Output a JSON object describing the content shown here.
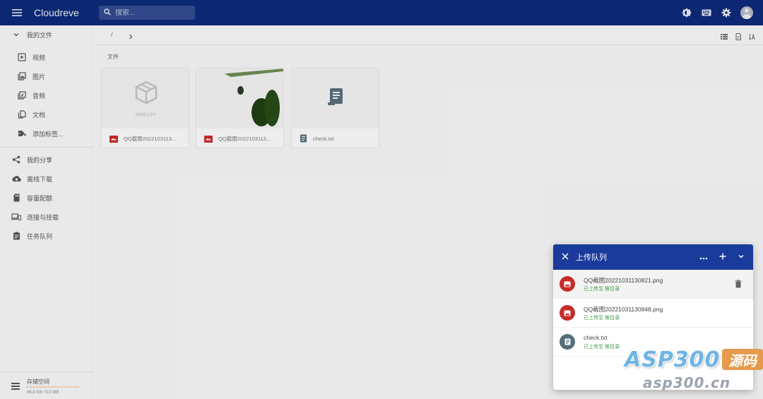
{
  "app": {
    "title": "Cloudreve"
  },
  "search": {
    "placeholder": "搜索..."
  },
  "sidebar": {
    "files_header": "我的文件",
    "sub_items": [
      {
        "label": "视频",
        "icon": "video-icon"
      },
      {
        "label": "图片",
        "icon": "image-icon"
      },
      {
        "label": "音频",
        "icon": "audio-icon"
      },
      {
        "label": "文档",
        "icon": "document-icon"
      },
      {
        "label": "添加标签...",
        "icon": "tag-add-icon"
      }
    ],
    "items": [
      {
        "label": "我的分享",
        "icon": "share-icon"
      },
      {
        "label": "离线下载",
        "icon": "cloud-download-icon"
      },
      {
        "label": "容量配额",
        "icon": "sd-card-icon"
      },
      {
        "label": "连接与挂载",
        "icon": "devices-icon"
      },
      {
        "label": "任务队列",
        "icon": "clipboard-icon"
      }
    ],
    "storage": {
      "label": "存储空间",
      "usage": "98.8 KB / 5.0 MB",
      "used_fraction": 0.02
    }
  },
  "main": {
    "breadcrumb": "/",
    "section_title": "文件",
    "files": [
      {
        "name": "QQ截图2022103113...",
        "type": "image",
        "thumb_text": "缩略图生成中"
      },
      {
        "name": "QQ截图2022103113...",
        "type": "image"
      },
      {
        "name": "check.txt",
        "type": "text"
      }
    ]
  },
  "upload_panel": {
    "title": "上传队列",
    "items": [
      {
        "name": "QQ截图20221031130821.png",
        "status": "已上传至 ",
        "folder": "根目录",
        "type": "image"
      },
      {
        "name": "QQ截图20221031130848.png",
        "status": "已上传至 ",
        "folder": "根目录",
        "type": "image"
      },
      {
        "name": "check.txt",
        "status": "已上传至 ",
        "folder": "根目录",
        "type": "text"
      }
    ]
  },
  "watermark": {
    "brand": "ASP300",
    "badge": "源码",
    "url": "asp300.cn"
  },
  "colors": {
    "appbar": "#0d2a77",
    "panel_head": "#1a3a9c",
    "success": "#3d9a44",
    "image_red": "#c82a2a",
    "text_blue_grey": "#546e7a"
  }
}
